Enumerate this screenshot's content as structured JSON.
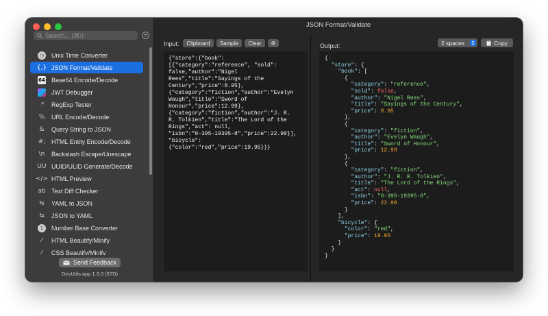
{
  "window": {
    "title": "JSON Format/Validate"
  },
  "sidebar": {
    "search_placeholder": "Search... (⌘/)",
    "items": [
      {
        "label": "Unix Time Converter",
        "icon": "clock-icon"
      },
      {
        "label": "JSON Format/Validate",
        "icon": "json-braces-icon",
        "selected": true
      },
      {
        "label": "Base64 Encode/Decode",
        "icon": "base64-icon"
      },
      {
        "label": "JWT Debugger",
        "icon": "jwt-icon"
      },
      {
        "label": "RegExp Tester",
        "icon": "regexp-icon"
      },
      {
        "label": "URL Encode/Decode",
        "icon": "percent-icon"
      },
      {
        "label": "Query String to JSON",
        "icon": "ampersand-icon"
      },
      {
        "label": "HTML Entity Encode/Decode",
        "icon": "html-entity-icon"
      },
      {
        "label": "Backslash Escape/Unescape",
        "icon": "backslash-icon"
      },
      {
        "label": "UUID/ULID Generate/Decode",
        "icon": "uuid-icon"
      },
      {
        "label": "HTML Preview",
        "icon": "code-icon"
      },
      {
        "label": "Text Diff Checker",
        "icon": "diff-icon"
      },
      {
        "label": "YAML to JSON",
        "icon": "arrows-swap-icon"
      },
      {
        "label": "JSON to YAML",
        "icon": "arrows-swap-icon"
      },
      {
        "label": "Number Base Converter",
        "icon": "number-base-icon"
      },
      {
        "label": "HTML Beautify/Minify",
        "icon": "wand-icon"
      },
      {
        "label": "CSS Beautify/Minify",
        "icon": "wand-icon"
      }
    ],
    "feedback_label": "Send Feedback",
    "version": "DevUtils.app 1.9.0 (67D)"
  },
  "input": {
    "label": "Input:",
    "buttons": {
      "clipboard": "Clipboard",
      "sample": "Sample",
      "clear": "Clear"
    },
    "text": "{\"store\":{\"book\":\n[{\"category\":\"reference\", \"sold\":\nfalse,\"author\":\"Nigel\nRees\",\"title\":\"Sayings of the\nCentury\",\"price\":8.95},\n{\"category\":\"fiction\",\"author\":\"Evelyn\nWaugh\",\"title\":\"Sword of\nHonour\",\"price\":12.99},\n{\"category\":\"fiction\",\"author\":\"J. R.\nR. Tolkien\",\"title\":\"The Lord of the\nRings\",\"act\": null,\n\"isbn\":\"0-395-19395-8\",\"price\":22.99}],\n\"bicycle\":\n{\"color\":\"red\",\"price\":19.95}}}"
  },
  "output": {
    "label": "Output:",
    "indent_option": "2 spaces",
    "copy_label": "Copy",
    "lines": [
      {
        "i": 0,
        "t": [
          [
            "p",
            "{"
          ]
        ]
      },
      {
        "i": 1,
        "t": [
          [
            "k",
            "\"store\""
          ],
          [
            "p",
            ": {"
          ]
        ]
      },
      {
        "i": 2,
        "t": [
          [
            "k",
            "\"book\""
          ],
          [
            "p",
            ": ["
          ]
        ]
      },
      {
        "i": 3,
        "t": [
          [
            "p",
            "{"
          ]
        ]
      },
      {
        "i": 4,
        "t": [
          [
            "k",
            "\"category\""
          ],
          [
            "p",
            ": "
          ],
          [
            "s",
            "\"reference\""
          ],
          [
            "p",
            ","
          ]
        ]
      },
      {
        "i": 4,
        "t": [
          [
            "k",
            "\"sold\""
          ],
          [
            "p",
            ": "
          ],
          [
            "b",
            "false"
          ],
          [
            "p",
            ","
          ]
        ]
      },
      {
        "i": 4,
        "t": [
          [
            "k",
            "\"author\""
          ],
          [
            "p",
            ": "
          ],
          [
            "s",
            "\"Nigel Rees\""
          ],
          [
            "p",
            ","
          ]
        ]
      },
      {
        "i": 4,
        "t": [
          [
            "k",
            "\"title\""
          ],
          [
            "p",
            ": "
          ],
          [
            "s",
            "\"Sayings of the Century\""
          ],
          [
            "p",
            ","
          ]
        ]
      },
      {
        "i": 4,
        "t": [
          [
            "k",
            "\"price\""
          ],
          [
            "p",
            ": "
          ],
          [
            "n",
            "8.95"
          ]
        ]
      },
      {
        "i": 3,
        "t": [
          [
            "p",
            "},"
          ]
        ]
      },
      {
        "i": 3,
        "t": [
          [
            "p",
            "{"
          ]
        ]
      },
      {
        "i": 4,
        "t": [
          [
            "k",
            "\"category\""
          ],
          [
            "p",
            ": "
          ],
          [
            "s",
            "\"fiction\""
          ],
          [
            "p",
            ","
          ]
        ]
      },
      {
        "i": 4,
        "t": [
          [
            "k",
            "\"author\""
          ],
          [
            "p",
            ": "
          ],
          [
            "s",
            "\"Evelyn Waugh\""
          ],
          [
            "p",
            ","
          ]
        ]
      },
      {
        "i": 4,
        "t": [
          [
            "k",
            "\"title\""
          ],
          [
            "p",
            ": "
          ],
          [
            "s",
            "\"Sword of Honour\""
          ],
          [
            "p",
            ","
          ]
        ]
      },
      {
        "i": 4,
        "t": [
          [
            "k",
            "\"price\""
          ],
          [
            "p",
            ": "
          ],
          [
            "n",
            "12.99"
          ]
        ]
      },
      {
        "i": 3,
        "t": [
          [
            "p",
            "},"
          ]
        ]
      },
      {
        "i": 3,
        "t": [
          [
            "p",
            "{"
          ]
        ]
      },
      {
        "i": 4,
        "t": [
          [
            "k",
            "\"category\""
          ],
          [
            "p",
            ": "
          ],
          [
            "s",
            "\"fiction\""
          ],
          [
            "p",
            ","
          ]
        ]
      },
      {
        "i": 4,
        "t": [
          [
            "k",
            "\"author\""
          ],
          [
            "p",
            ": "
          ],
          [
            "s",
            "\"J. R. R. Tolkien\""
          ],
          [
            "p",
            ","
          ]
        ]
      },
      {
        "i": 4,
        "t": [
          [
            "k",
            "\"title\""
          ],
          [
            "p",
            ": "
          ],
          [
            "s",
            "\"The Lord of the Rings\""
          ],
          [
            "p",
            ","
          ]
        ]
      },
      {
        "i": 4,
        "t": [
          [
            "k",
            "\"act\""
          ],
          [
            "p",
            ": "
          ],
          [
            "b",
            "null"
          ],
          [
            "p",
            ","
          ]
        ]
      },
      {
        "i": 4,
        "t": [
          [
            "k",
            "\"isbn\""
          ],
          [
            "p",
            ": "
          ],
          [
            "s",
            "\"0-395-19395-8\""
          ],
          [
            "p",
            ","
          ]
        ]
      },
      {
        "i": 4,
        "t": [
          [
            "k",
            "\"price\""
          ],
          [
            "p",
            ": "
          ],
          [
            "n",
            "22.99"
          ]
        ]
      },
      {
        "i": 3,
        "t": [
          [
            "p",
            "}"
          ]
        ]
      },
      {
        "i": 2,
        "t": [
          [
            "p",
            "],"
          ]
        ]
      },
      {
        "i": 2,
        "t": [
          [
            "k",
            "\"bicycle\""
          ],
          [
            "p",
            ": {"
          ]
        ]
      },
      {
        "i": 3,
        "t": [
          [
            "k",
            "\"color\""
          ],
          [
            "p",
            ": "
          ],
          [
            "s",
            "\"red\""
          ],
          [
            "p",
            ","
          ]
        ]
      },
      {
        "i": 3,
        "t": [
          [
            "k",
            "\"price\""
          ],
          [
            "p",
            ": "
          ],
          [
            "n",
            "19.95"
          ]
        ]
      },
      {
        "i": 2,
        "t": [
          [
            "p",
            "}"
          ]
        ]
      },
      {
        "i": 1,
        "t": [
          [
            "p",
            "}"
          ]
        ]
      },
      {
        "i": 0,
        "t": [
          [
            "p",
            "}"
          ]
        ]
      }
    ]
  },
  "colors": {
    "accent": "#1b6fe0",
    "json_key": "#8fd3e8",
    "json_string": "#87dd7c",
    "json_number": "#f6a733",
    "json_literal": "#ff6b63"
  }
}
